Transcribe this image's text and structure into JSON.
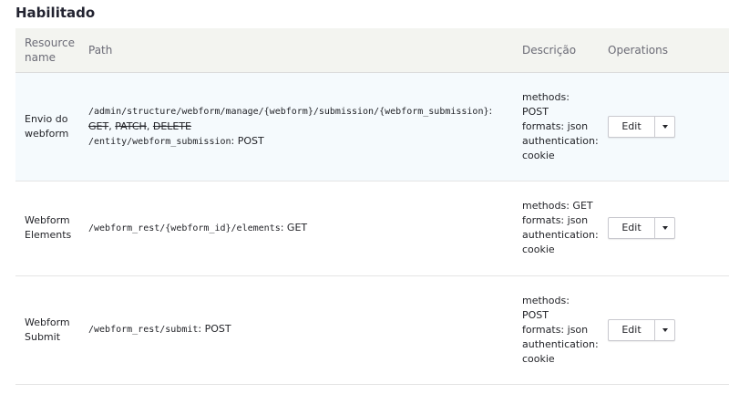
{
  "section": {
    "title": "Habilitado"
  },
  "table": {
    "headers": {
      "name": "Resource name",
      "path": "Path",
      "description": "Descrição",
      "operations": "Operations"
    },
    "rows": [
      {
        "name": "Envio do webform",
        "path1_code": "/admin/structure/webform/manage/{webform}/submission/{webform_submission}",
        "path1_suffix": ":",
        "struck_methods": {
          "get": "GET",
          "sep1": ", ",
          "patch": "PATCH",
          "sep2": ", ",
          "delete": "DELETE"
        },
        "path2_code": "/entity/webform_submission",
        "path2_suffix": ": POST",
        "description": [
          "methods:",
          "POST",
          "formats: json",
          "authentication:",
          "cookie"
        ],
        "edit_label": "Edit"
      },
      {
        "name": "Webform Elements",
        "path1_code": "/webform_rest/{webform_id}/elements",
        "path1_suffix": ": GET",
        "description": [
          "methods: GET",
          "formats: json",
          "authentication:",
          "cookie"
        ],
        "edit_label": "Edit"
      },
      {
        "name": "Webform Submit",
        "path1_code": "/webform_rest/submit",
        "path1_suffix": ": POST",
        "description": [
          "methods:",
          "POST",
          "formats: json",
          "authentication:",
          "cookie"
        ],
        "edit_label": "Edit"
      }
    ]
  }
}
